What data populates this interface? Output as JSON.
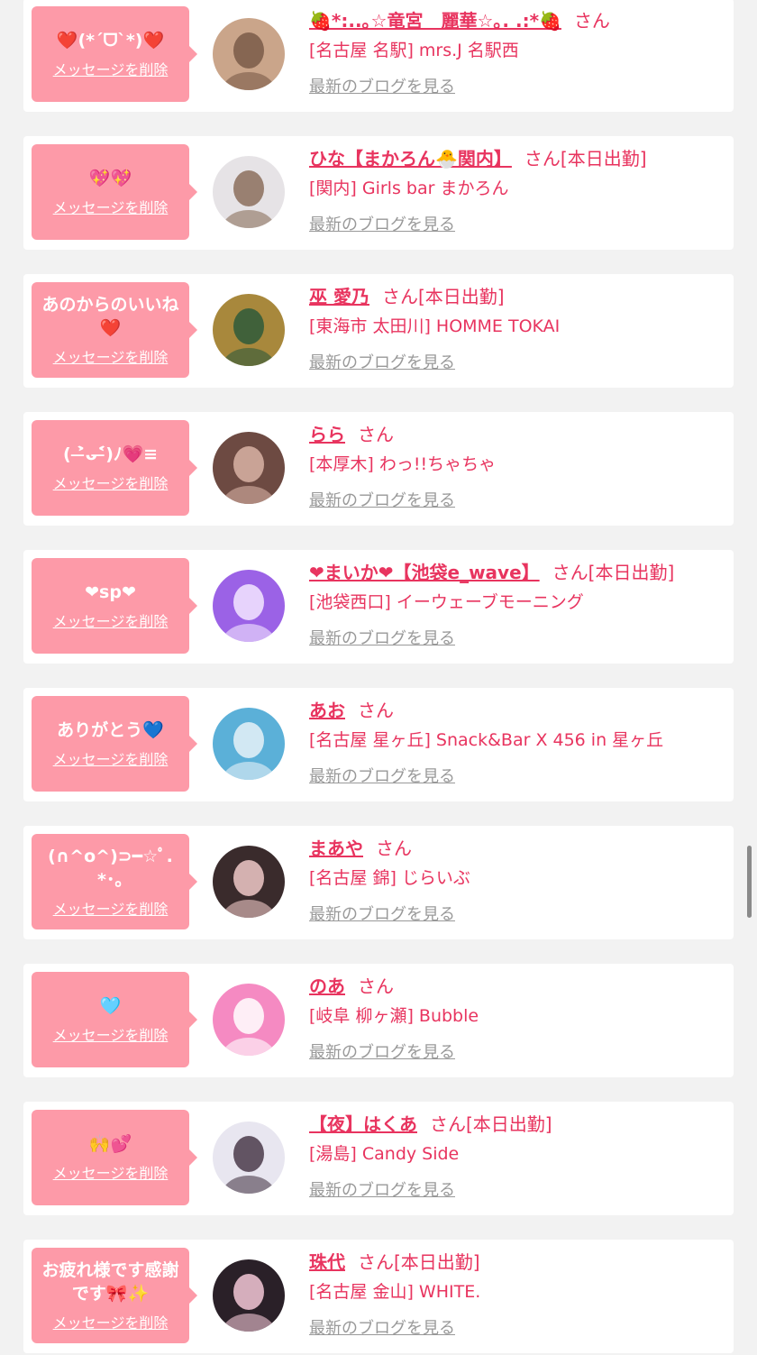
{
  "colors": {
    "background": "#f2f2f2",
    "card": "#ffffff",
    "bubble": "#fd9aa8",
    "name": "#e8345f",
    "link_gray": "#999999"
  },
  "labels": {
    "delete": "メッセージを削除",
    "view_blog": "最新のブログを見る",
    "san": "さん"
  },
  "items": [
    {
      "message": "❤️(*ˊᗜˋ*)❤️",
      "name": "🍓*:..｡☆竜宮　麗華☆｡. .:*🍓",
      "status": "",
      "shop": "[名古屋 名駅] mrs.J 名駅西",
      "avatar_colors": [
        "#caa58a",
        "#7a5a48"
      ]
    },
    {
      "message": "💖💖",
      "name": "ひな【まかろん🐣関内】",
      "status": "[本日出勤]",
      "shop": "[関内] Girls bar まかろん",
      "avatar_colors": [
        "#e6e3e6",
        "#8b6f5c"
      ]
    },
    {
      "message": "あのからのいいね❤️",
      "name": "巫 愛乃",
      "status": "[本日出勤]",
      "shop": "[東海市 太田川] HOMME TOKAI",
      "avatar_colors": [
        "#a8883c",
        "#2e5a3a"
      ]
    },
    {
      "message": "( ˃̶̀ᴗ˂̶́)ﾉ💗≡",
      "name": "らら",
      "status": "",
      "shop": "[本厚木] わっ!!ちゃちゃ",
      "avatar_colors": [
        "#6d4a42",
        "#d9b3a5"
      ]
    },
    {
      "message": "❤sp❤",
      "name": "❤まいか❤【池袋e_wave】",
      "status": "[本日出勤]",
      "shop": "[池袋西口] イーウェーブモーニング",
      "avatar_colors": [
        "#9b62e6",
        "#f4e8ff"
      ]
    },
    {
      "message": "ありがとう💙",
      "name": "あお",
      "status": "",
      "shop": "[名古屋 星ヶ丘] Snack&Bar X 456 in 星ヶ丘",
      "avatar_colors": [
        "#5bb0d8",
        "#e7f2f8"
      ]
    },
    {
      "message": "(∩^o^)⊃━☆ﾟ.*･｡",
      "name": "まあや",
      "status": "",
      "shop": "[名古屋 錦] じらいぶ",
      "avatar_colors": [
        "#3a2b2c",
        "#f0c9c8"
      ]
    },
    {
      "message": "🩵",
      "name": "のあ",
      "status": "",
      "shop": "[岐阜 柳ヶ瀬] Bubble",
      "avatar_colors": [
        "#f58ac2",
        "#ffffff"
      ]
    },
    {
      "message": "🙌💕",
      "name": "【夜】はくあ",
      "status": "[本日出勤]",
      "shop": "[湯島] Candy Side",
      "avatar_colors": [
        "#e8e6f0",
        "#4a3a4a"
      ]
    },
    {
      "message": "お疲れ様です感謝です🎀✨",
      "name": "珠代",
      "status": "[本日出勤]",
      "shop": "[名古屋 金山] WHITE.",
      "avatar_colors": [
        "#2a2028",
        "#f3c8d6"
      ]
    }
  ]
}
